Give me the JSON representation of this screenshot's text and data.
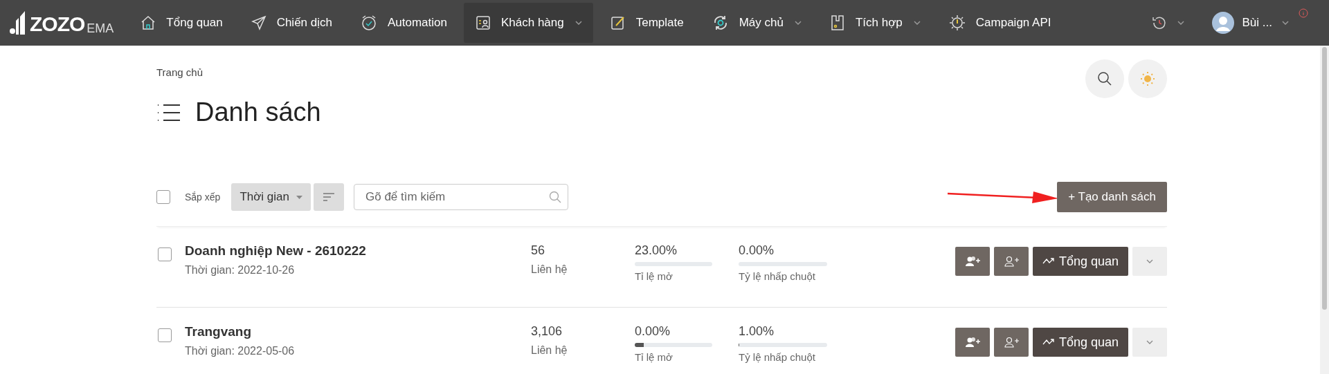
{
  "nav": {
    "logo": "ZOZO",
    "logo_suffix": "EMA",
    "items": [
      {
        "label": "Tổng quan",
        "dropdown": false,
        "selected": false
      },
      {
        "label": "Chiến dịch",
        "dropdown": false,
        "selected": false
      },
      {
        "label": "Automation",
        "dropdown": false,
        "selected": false
      },
      {
        "label": "Khách hàng",
        "dropdown": true,
        "selected": true
      },
      {
        "label": "Template",
        "dropdown": false,
        "selected": false
      },
      {
        "label": "Máy chủ",
        "dropdown": true,
        "selected": false
      },
      {
        "label": "Tích hợp",
        "dropdown": true,
        "selected": false
      },
      {
        "label": "Campaign API",
        "dropdown": false,
        "selected": false
      }
    ],
    "user": {
      "name": "Bùi ...",
      "notification": true
    }
  },
  "breadcrumb": "Trang chủ",
  "page_title": "Danh sách",
  "toolbar": {
    "select_all_checked": false,
    "sort_label": "Sắp xếp",
    "sort_value": "Thời gian",
    "search": {
      "placeholder": "Gõ để tìm kiếm"
    },
    "create_button": "+ Tạo danh sách"
  },
  "lists": [
    {
      "name": "Doanh nghiệp New - 2610222",
      "date": "Thời gian: 2022-10-26",
      "count": "56",
      "count_label": "Liên hệ",
      "open_rate": {
        "value": "23.00%",
        "label": "Tỉ lệ mở",
        "level": 0
      },
      "click_rate": {
        "value": "0.00%",
        "label": "Tỷ lệ nhấp chuột",
        "level": 0
      },
      "overview_button": "Tổng quan",
      "checked": false
    },
    {
      "name": "Trangvang",
      "date": "Thời gian: 2022-05-06",
      "count": "3,106",
      "count_label": "Liên hệ",
      "open_rate": {
        "value": "0.00%",
        "label": "Tỉ lệ mở",
        "level": 0.12
      },
      "click_rate": {
        "value": "1.00%",
        "label": "Tỷ lệ nhấp chuột",
        "level": 0.01
      },
      "overview_button": "Tổng quan",
      "checked": false
    }
  ]
}
